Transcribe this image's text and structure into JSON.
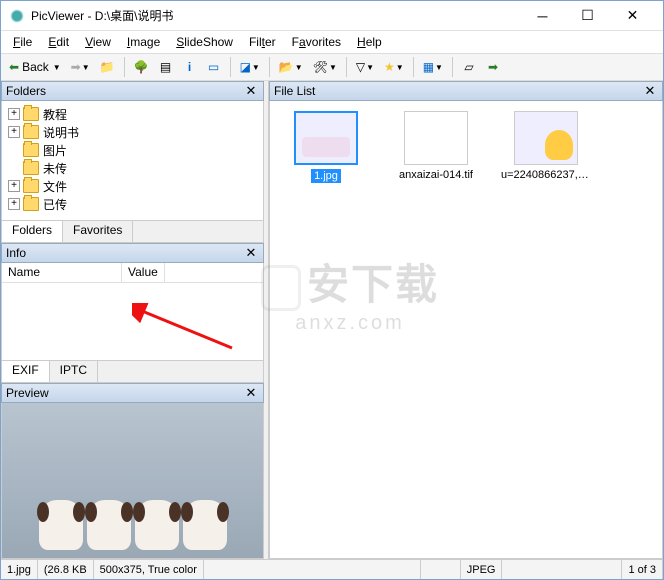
{
  "window": {
    "app": "PicViewer",
    "title": "PicViewer - D:\\桌面\\说明书"
  },
  "menu": {
    "file": "File",
    "edit": "Edit",
    "view": "View",
    "image": "Image",
    "slideshow": "SlideShow",
    "filter": "Filter",
    "favorites": "Favorites",
    "help": "Help"
  },
  "toolbar": {
    "back": "Back"
  },
  "panels": {
    "folders": "Folders",
    "info": "Info",
    "preview": "Preview",
    "filelist": "File List"
  },
  "tree": [
    {
      "label": "教程",
      "expandable": true
    },
    {
      "label": "说明书",
      "expandable": true
    },
    {
      "label": "图片",
      "expandable": false
    },
    {
      "label": "未传",
      "expandable": false
    },
    {
      "label": "文件",
      "expandable": true
    },
    {
      "label": "已传",
      "expandable": true
    }
  ],
  "left_tabs": {
    "folders": "Folders",
    "favorites": "Favorites"
  },
  "info_cols": {
    "name": "Name",
    "value": "Value"
  },
  "info_tabs": {
    "exif": "EXIF",
    "iptc": "IPTC"
  },
  "files": [
    {
      "name": "1.jpg",
      "selected": true
    },
    {
      "name": "anxaizai-014.tif",
      "selected": false
    },
    {
      "name": "u=2240866237,2...",
      "selected": false
    }
  ],
  "status": {
    "file": "1.jpg",
    "size": "(26.8 KB",
    "dims": "500x375, True color",
    "format": "JPEG",
    "count": "1 of 3"
  },
  "watermark": {
    "top": "安下载",
    "bottom": "anxz.com"
  }
}
